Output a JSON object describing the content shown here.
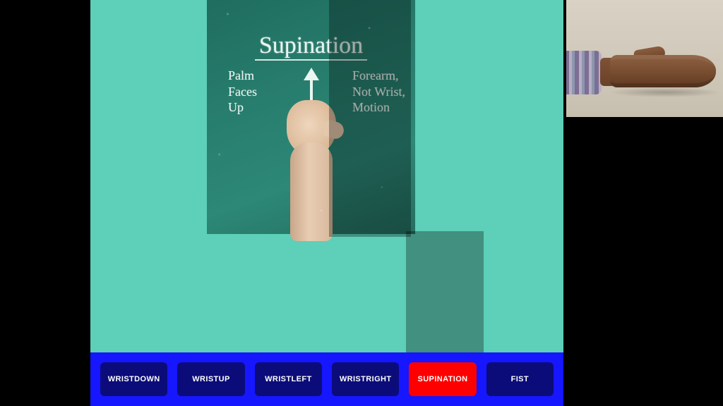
{
  "colors": {
    "bg": "#000000",
    "teal": "#5ecfb8",
    "bar": "#1616ff",
    "button": "#0b0c7a",
    "button_active": "#ff0000",
    "chalkboard": "#287e6e"
  },
  "chalkboard": {
    "title": "Supination",
    "left_text": "Palm\nFaces\nUp",
    "right_text": "Forearm,\nNot Wrist,\nMotion"
  },
  "buttons": [
    {
      "id": "wristdown",
      "label": "WRISTDOWN",
      "active": false
    },
    {
      "id": "wristup",
      "label": "WRISTUP",
      "active": false
    },
    {
      "id": "wristleft",
      "label": "WRISTLEFT",
      "active": false
    },
    {
      "id": "wristright",
      "label": "WRISTRIGHT",
      "active": false
    },
    {
      "id": "supination",
      "label": "SUPINATION",
      "active": true
    },
    {
      "id": "fist",
      "label": "FIST",
      "active": false
    }
  ],
  "camera": {
    "description": "live-hand-supinated"
  }
}
